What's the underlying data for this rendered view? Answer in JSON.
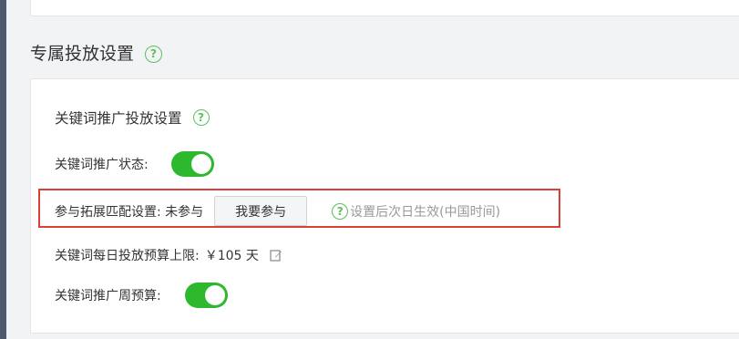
{
  "section": {
    "title": "专属投放设置",
    "help_icon": "question-circle-icon"
  },
  "keyword_promotion": {
    "heading": "关键词推广投放设置",
    "status_label": "关键词推广状态:",
    "status_enabled": true,
    "expand_match_label": "参与拓展匹配设置: 未参与",
    "join_button": "我要参与",
    "effective_hint": "设置后次日生效(中国时间)",
    "daily_budget_label": "关键词每日投放预算上限:",
    "daily_budget_value": "￥105 天",
    "edit_icon": "edit-icon",
    "weekly_budget_label": "关键词推广周预算:",
    "weekly_budget_enabled": true
  },
  "colors": {
    "accent_green": "#2eb82e",
    "help_green": "#5cc05c",
    "highlight_red": "#d9403a"
  }
}
